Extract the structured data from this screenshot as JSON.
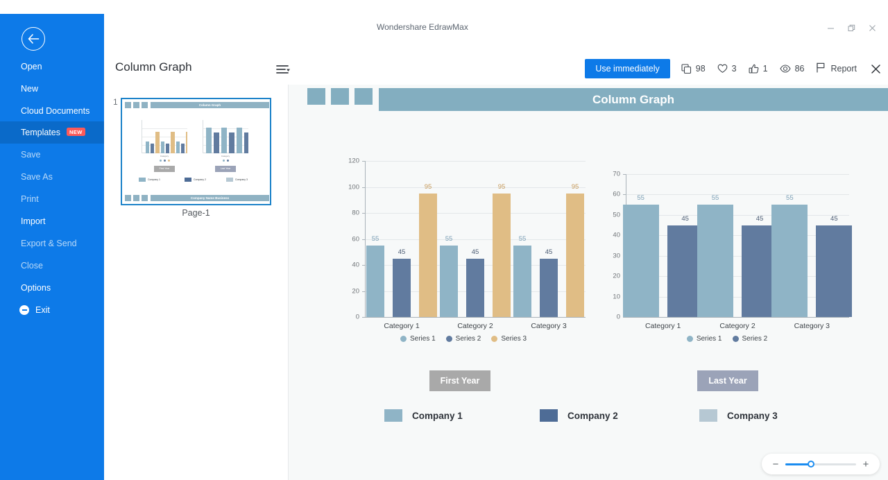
{
  "window": {
    "app_title": "Wondershare EdrawMax",
    "controls": [
      {
        "name": "minimize",
        "glyph": "–"
      },
      {
        "name": "restore",
        "glyph": "❐"
      },
      {
        "name": "close",
        "glyph": "✕"
      }
    ]
  },
  "sidebar": {
    "back_icon": "back-arrow-icon",
    "items": [
      {
        "label": "Open",
        "state": "normal"
      },
      {
        "label": "New",
        "state": "normal"
      },
      {
        "label": "Cloud Documents",
        "state": "normal"
      },
      {
        "label": "Templates",
        "state": "active",
        "badge": "NEW"
      },
      {
        "label": "Save",
        "state": "dim"
      },
      {
        "label": "Save As",
        "state": "dim"
      },
      {
        "label": "Print",
        "state": "dim"
      },
      {
        "label": "Import",
        "state": "normal"
      },
      {
        "label": "Export & Send",
        "state": "dim"
      },
      {
        "label": "Close",
        "state": "dim"
      },
      {
        "label": "Options",
        "state": "normal"
      },
      {
        "label": "Exit",
        "state": "normal"
      }
    ]
  },
  "template_header": {
    "name": "Column Graph",
    "list_icon": "list-sort-icon",
    "use_button": "Use immediately",
    "stats": [
      {
        "icon": "copy-icon",
        "value": "98"
      },
      {
        "icon": "heart-icon",
        "value": "3"
      },
      {
        "icon": "thumbs-up-icon",
        "value": "1"
      },
      {
        "icon": "eye-icon",
        "value": "86"
      }
    ],
    "report_label": "Report",
    "close_icon": "close-icon"
  },
  "thumbnail": {
    "page_number": "1",
    "caption": "Page-1",
    "title": "Column Graph"
  },
  "canvas": {
    "banner_title": "Column Graph",
    "banner_color": "#83aec0",
    "buttons": [
      {
        "label": "First Year",
        "color": "#a9a9a9"
      },
      {
        "label": "Last Year",
        "color": "#9ba3b8"
      }
    ],
    "company_legend": [
      {
        "label": "Company 1",
        "color": "#8fb4c6"
      },
      {
        "label": "Company 2",
        "color": "#4e6party"
      },
      {
        "label": "Company 3",
        "color": "#b6c8d3"
      }
    ]
  },
  "company_legend_fixed": [
    {
      "label": "Company 1",
      "color": "#8fb4c6"
    },
    {
      "label": "Company 2",
      "color": "#4e6c96"
    },
    {
      "label": "Company 3",
      "color": "#b6c8d3"
    }
  ],
  "zoom_control": {
    "minus": "−",
    "plus": "+",
    "value": 36
  },
  "chart_data": [
    {
      "type": "bar",
      "title": "First Year",
      "categories": [
        "Category 1",
        "Category 2",
        "Category 3"
      ],
      "series": [
        {
          "name": "Series 1",
          "color": "#8fb4c6",
          "values": [
            55,
            55,
            55
          ]
        },
        {
          "name": "Series 2",
          "color": "#617b9f",
          "values": [
            45,
            45,
            45
          ]
        },
        {
          "name": "Series 3",
          "color": "#e0bd85",
          "values": [
            95,
            95,
            95
          ]
        }
      ],
      "ylim": [
        0,
        120
      ],
      "yticks": [
        0,
        20,
        40,
        60,
        80,
        100,
        120
      ],
      "xlabel": "",
      "ylabel": "",
      "grid": true,
      "legend_position": "bottom",
      "data_labels": true
    },
    {
      "type": "bar",
      "title": "Last Year",
      "categories": [
        "Category 1",
        "Category 2",
        "Category 3"
      ],
      "series": [
        {
          "name": "Series 1",
          "color": "#8fb4c6",
          "values": [
            55,
            55,
            55
          ]
        },
        {
          "name": "Series 2",
          "color": "#617b9f",
          "values": [
            45,
            45,
            45
          ]
        }
      ],
      "ylim": [
        0,
        70
      ],
      "yticks": [
        0,
        10,
        20,
        30,
        40,
        50,
        60,
        70
      ],
      "xlabel": "",
      "ylabel": "",
      "grid": true,
      "legend_position": "bottom",
      "data_labels": true
    }
  ]
}
